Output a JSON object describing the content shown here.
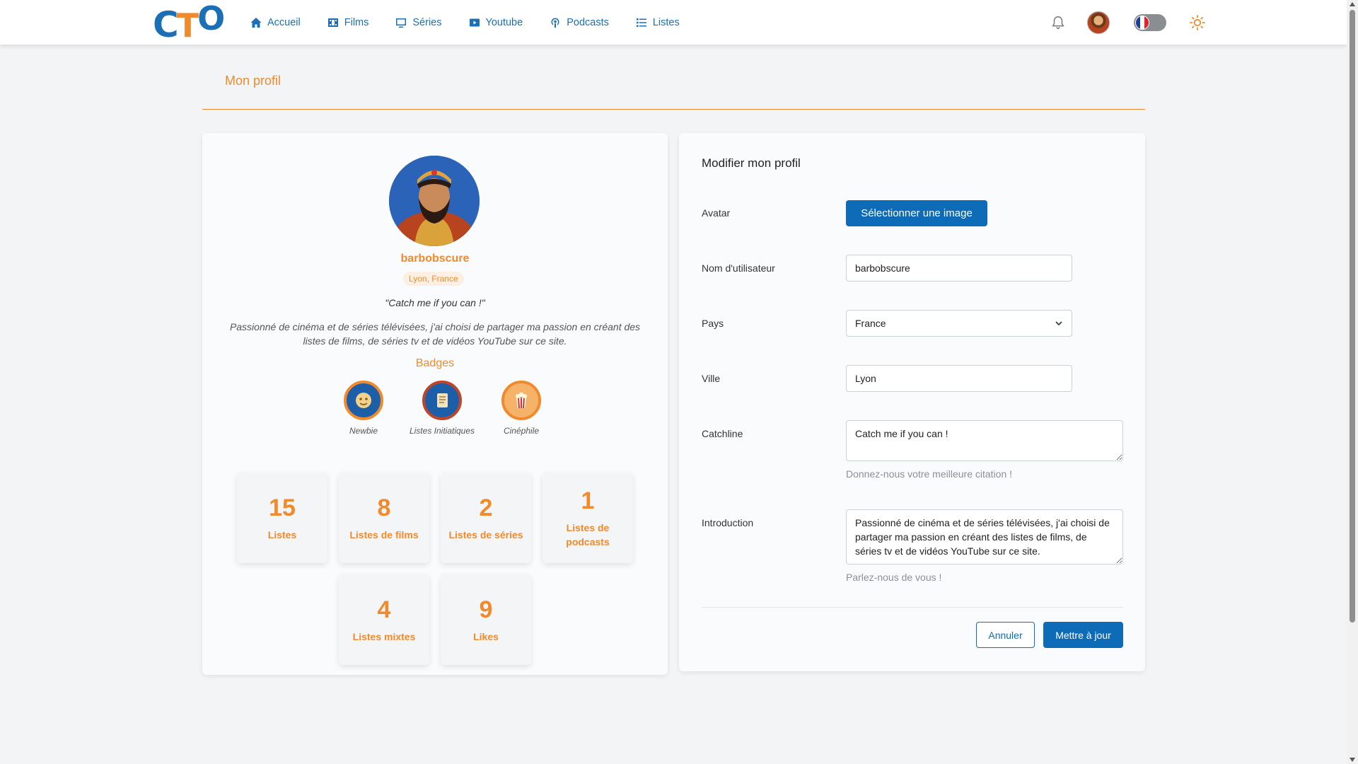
{
  "brand": {
    "logo_c": "C",
    "logo_t": "T",
    "logo_o": "O"
  },
  "nav": [
    {
      "label": "Accueil",
      "icon": "home-icon"
    },
    {
      "label": "Films",
      "icon": "film-icon"
    },
    {
      "label": "Séries",
      "icon": "tv-icon"
    },
    {
      "label": "Youtube",
      "icon": "youtube-icon"
    },
    {
      "label": "Podcasts",
      "icon": "podcast-icon"
    },
    {
      "label": "Listes",
      "icon": "list-icon"
    }
  ],
  "page": {
    "title": "Mon profil"
  },
  "profile": {
    "username": "barbobscure",
    "location": "Lyon, France",
    "catchline": "\"Catch me if you can !\"",
    "intro": "Passionné de cinéma et de séries télévisées, j'ai choisi de partager ma passion en créant des listes de films, de séries tv et de vidéos YouTube sur ce site.",
    "badges_title": "Badges",
    "badges": [
      {
        "label": "Newbie",
        "icon": "newbie-badge-icon"
      },
      {
        "label": "Listes Initiatiques",
        "icon": "scroll-badge-icon"
      },
      {
        "label": "Cinéphile",
        "icon": "popcorn-badge-icon"
      }
    ],
    "stats": [
      {
        "value": "15",
        "label": "Listes"
      },
      {
        "value": "8",
        "label": "Listes de films"
      },
      {
        "value": "2",
        "label": "Listes de séries"
      },
      {
        "value": "1",
        "label": "Listes de podcasts"
      },
      {
        "value": "4",
        "label": "Listes mixtes"
      },
      {
        "value": "9",
        "label": "Likes"
      }
    ]
  },
  "form": {
    "title": "Modifier mon profil",
    "avatar_label": "Avatar",
    "avatar_button": "Sélectionner une image",
    "username_label": "Nom d'utilisateur",
    "username_value": "barbobscure",
    "country_label": "Pays",
    "country_value": "France",
    "city_label": "Ville",
    "city_value": "Lyon",
    "catchline_label": "Catchline",
    "catchline_value": "Catch me if you can !",
    "catchline_help": "Donnez-nous votre meilleure citation !",
    "intro_label": "Introduction",
    "intro_value": "Passionné de cinéma et de séries télévisées, j'ai choisi de partager ma passion en créant des listes de films, de séries tv et de vidéos YouTube sur ce site.",
    "intro_help": "Parlez-nous de vous !",
    "cancel": "Annuler",
    "submit": "Mettre à jour"
  },
  "colors": {
    "accent": "#f08a2c",
    "primary": "#0d6bb8"
  }
}
